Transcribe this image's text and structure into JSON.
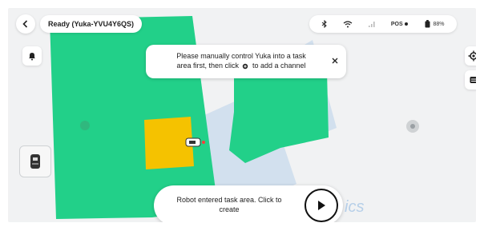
{
  "header": {
    "status_label": "Ready (Yuka-YVU4Y6QS)",
    "pos_label": "POS",
    "battery_label": "88%"
  },
  "tip": {
    "line1": "Please manually control Yuka into a task",
    "line2_a": "area first, then click",
    "line2_b": "to add a channel"
  },
  "robot_card": {
    "line1": "Robot entered task area. Click to",
    "line2": "create"
  },
  "watermark": "ics",
  "colors": {
    "lawn": "#22d089",
    "area": "#f5c200",
    "background": "#f1f2f3",
    "watermark": "#4a8fd6"
  },
  "icons": [
    "back-icon",
    "bell-icon",
    "bluetooth-icon",
    "wifi-icon",
    "signal-icon",
    "pos-icon",
    "battery-icon",
    "close-icon",
    "locate-icon",
    "layers-icon",
    "play-icon",
    "dock-icon"
  ]
}
